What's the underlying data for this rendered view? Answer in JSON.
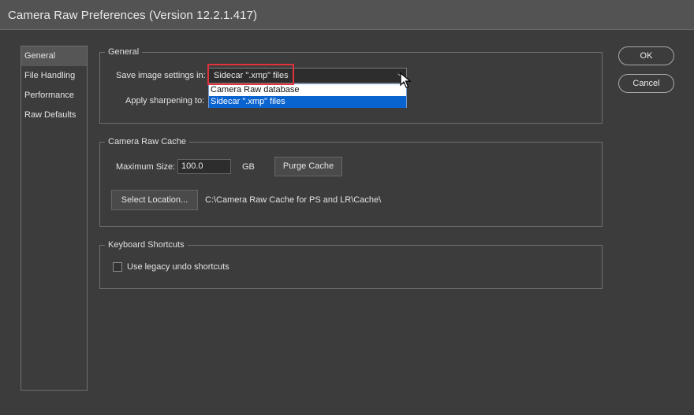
{
  "window": {
    "title": "Camera Raw Preferences  (Version 12.2.1.417)"
  },
  "sidebar": {
    "items": [
      {
        "label": "General"
      },
      {
        "label": "File Handling"
      },
      {
        "label": "Performance"
      },
      {
        "label": "Raw Defaults"
      }
    ],
    "active": "General"
  },
  "general": {
    "legend": "General",
    "save_label": "Save image settings in:",
    "save_value": "Sidecar \".xmp\" files",
    "options": [
      "Camera Raw database",
      "Sidecar \".xmp\" files"
    ],
    "selected_option": "Sidecar \".xmp\" files",
    "sharpen_label": "Apply sharpening to:"
  },
  "cache": {
    "legend": "Camera Raw Cache",
    "max_size_label": "Maximum Size:",
    "max_size_value": "100.0",
    "unit": "GB",
    "purge_label": "Purge Cache",
    "select_location_label": "Select Location...",
    "location_path": "C:\\Camera Raw Cache for PS and LR\\Cache\\"
  },
  "shortcuts": {
    "legend": "Keyboard Shortcuts",
    "legacy_label": "Use legacy undo shortcuts",
    "legacy_checked": false
  },
  "actions": {
    "ok_label": "OK",
    "cancel_label": "Cancel"
  },
  "colors": {
    "highlight": "#e0333b",
    "selection": "#0a64d0"
  }
}
